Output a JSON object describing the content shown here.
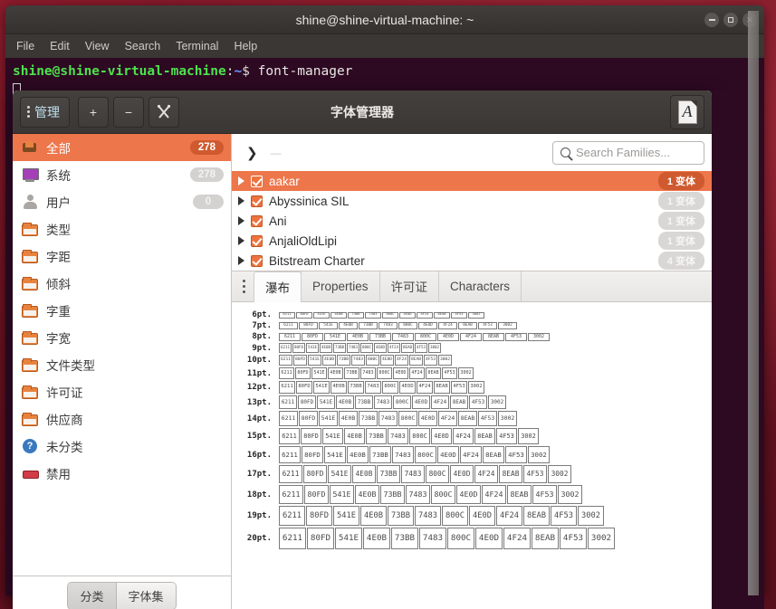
{
  "terminal": {
    "title": "shine@shine-virtual-machine: ~",
    "menu": [
      "File",
      "Edit",
      "View",
      "Search",
      "Terminal",
      "Help"
    ],
    "prompt_user": "shine@shine-virtual-machine",
    "prompt_colon": ":",
    "prompt_path": "~",
    "prompt_dollar": "$",
    "command": "font-manager",
    "window_buttons": [
      "minimize-button",
      "maximize-button",
      "close-button"
    ]
  },
  "fontmanager": {
    "title": "字体管理器",
    "toolbar": {
      "manage_label": "管理",
      "add_label": "+",
      "remove_label": "−",
      "tools_label": "tools-icon",
      "font_icon_letter": "A"
    },
    "sidebar": {
      "categories": [
        {
          "label": "全部",
          "badge": "278",
          "icon": "all-fonts-icon",
          "selected": true,
          "icon_class": "ic-all"
        },
        {
          "label": "系统",
          "badge": "278",
          "icon": "system-icon",
          "selected": false,
          "icon_class": "ic-system"
        },
        {
          "label": "用户",
          "badge": "0",
          "icon": "user-icon",
          "selected": false,
          "icon_class": "ic-user"
        },
        {
          "label": "类型",
          "badge": "",
          "icon": "folder-icon",
          "selected": false,
          "icon_class": "ic-folder"
        },
        {
          "label": "字距",
          "badge": "",
          "icon": "folder-icon",
          "selected": false,
          "icon_class": "ic-folder"
        },
        {
          "label": "倾斜",
          "badge": "",
          "icon": "folder-icon",
          "selected": false,
          "icon_class": "ic-folder"
        },
        {
          "label": "字重",
          "badge": "",
          "icon": "folder-icon",
          "selected": false,
          "icon_class": "ic-folder"
        },
        {
          "label": "字宽",
          "badge": "",
          "icon": "folder-icon",
          "selected": false,
          "icon_class": "ic-folder"
        },
        {
          "label": "文件类型",
          "badge": "",
          "icon": "folder-icon",
          "selected": false,
          "icon_class": "ic-folder"
        },
        {
          "label": "许可证",
          "badge": "",
          "icon": "folder-icon",
          "selected": false,
          "icon_class": "ic-folder"
        },
        {
          "label": "供应商",
          "badge": "",
          "icon": "folder-icon",
          "selected": false,
          "icon_class": "ic-folder"
        },
        {
          "label": "未分类",
          "badge": "",
          "icon": "unknown-icon",
          "selected": false,
          "icon_class": "ic-unknown"
        },
        {
          "label": "禁用",
          "badge": "",
          "icon": "disabled-icon",
          "selected": false,
          "icon_class": "ic-disabled"
        }
      ],
      "footer_segments": [
        {
          "label": "分类",
          "active": true
        },
        {
          "label": "字体集",
          "active": false
        }
      ]
    },
    "list": {
      "search_placeholder": "Search Families...",
      "expander_dash": "—",
      "families": [
        {
          "name": "aakar",
          "variants": "1 变体",
          "checked": true,
          "selected": true
        },
        {
          "name": "Abyssinica SIL",
          "variants": "1 变体",
          "checked": true,
          "selected": false
        },
        {
          "name": "Ani",
          "variants": "1 变体",
          "checked": true,
          "selected": false
        },
        {
          "name": "AnjaliOldLipi",
          "variants": "1 变体",
          "checked": true,
          "selected": false
        },
        {
          "name": "Bitstream Charter",
          "variants": "4 变体",
          "checked": true,
          "selected": false
        }
      ]
    },
    "detail": {
      "tabs": [
        {
          "label": "瀑布",
          "active": true
        },
        {
          "label": "Properties",
          "active": false
        },
        {
          "label": "许可证",
          "active": false
        },
        {
          "label": "Characters",
          "active": false
        }
      ],
      "waterfall": {
        "codepoints": [
          "6211",
          "80FD",
          "541E",
          "4E0B",
          "73BB",
          "7483",
          "800C",
          "4E0D",
          "4F24",
          "8EAB",
          "4F53",
          "3002"
        ],
        "rows": [
          {
            "size_label": "6pt.",
            "pt": 6
          },
          {
            "size_label": "7pt.",
            "pt": 7
          },
          {
            "size_label": "8pt.",
            "pt": 8
          },
          {
            "size_label": "9pt.",
            "pt": 9
          },
          {
            "size_label": "10pt.",
            "pt": 10
          },
          {
            "size_label": "11pt.",
            "pt": 11
          },
          {
            "size_label": "12pt.",
            "pt": 12
          },
          {
            "size_label": "13pt.",
            "pt": 13
          },
          {
            "size_label": "14pt.",
            "pt": 14
          },
          {
            "size_label": "15pt.",
            "pt": 15
          },
          {
            "size_label": "16pt.",
            "pt": 16
          },
          {
            "size_label": "17pt.",
            "pt": 17
          },
          {
            "size_label": "18pt.",
            "pt": 18
          },
          {
            "size_label": "19pt.",
            "pt": 19
          },
          {
            "size_label": "20pt.",
            "pt": 20
          }
        ]
      }
    }
  },
  "colors": {
    "accent_orange": "#ed764b",
    "badge_orange": "#cf5a2f",
    "terminal_bg": "#2d0922",
    "titlebar": "#3a3734",
    "prompt_green": "#4ee24e"
  }
}
